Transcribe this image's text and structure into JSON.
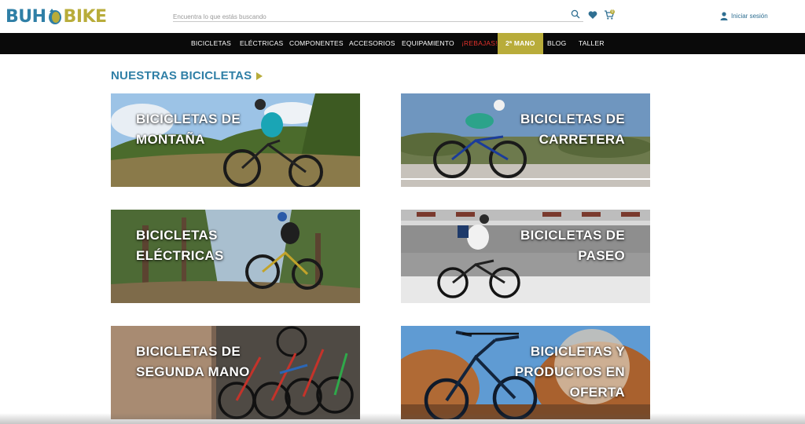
{
  "brand": {
    "logo_left": "BUH",
    "logo_right": "BIKE"
  },
  "search": {
    "placeholder": "Encuentra lo que estás buscando"
  },
  "header": {
    "cart_count": "0",
    "login_label": "Iniciar sesión"
  },
  "nav": {
    "items": [
      "BICICLETAS",
      "ELÉCTRICAS",
      "COMPONENTES",
      "ACCESORIOS",
      "EQUIPAMIENTO",
      "¡REBAJAS!",
      "2ª MANO",
      "BLOG",
      "TALLER"
    ]
  },
  "main": {
    "title": "NUESTRAS BICICLETAS",
    "cards": [
      {
        "lines": [
          "BICICLETAS DE",
          "MONTAÑA"
        ]
      },
      {
        "lines": [
          "BICICLETAS DE",
          "CARRETERA"
        ]
      },
      {
        "lines": [
          "BICICLETAS",
          "ELÉCTRICAS"
        ]
      },
      {
        "lines": [
          "BICICLETAS DE",
          "PASEO"
        ]
      },
      {
        "lines": [
          "BICICLETAS DE",
          "SEGUNDA MANO"
        ]
      },
      {
        "lines": [
          "BICICLETAS Y",
          "PRODUCTOS EN",
          "OFERTA"
        ]
      }
    ]
  },
  "colors": {
    "brand_blue": "#2f7fa6",
    "brand_olive": "#b8ac3a",
    "nav_bg": "#0a0a0a",
    "sale_red": "#e2312b"
  }
}
